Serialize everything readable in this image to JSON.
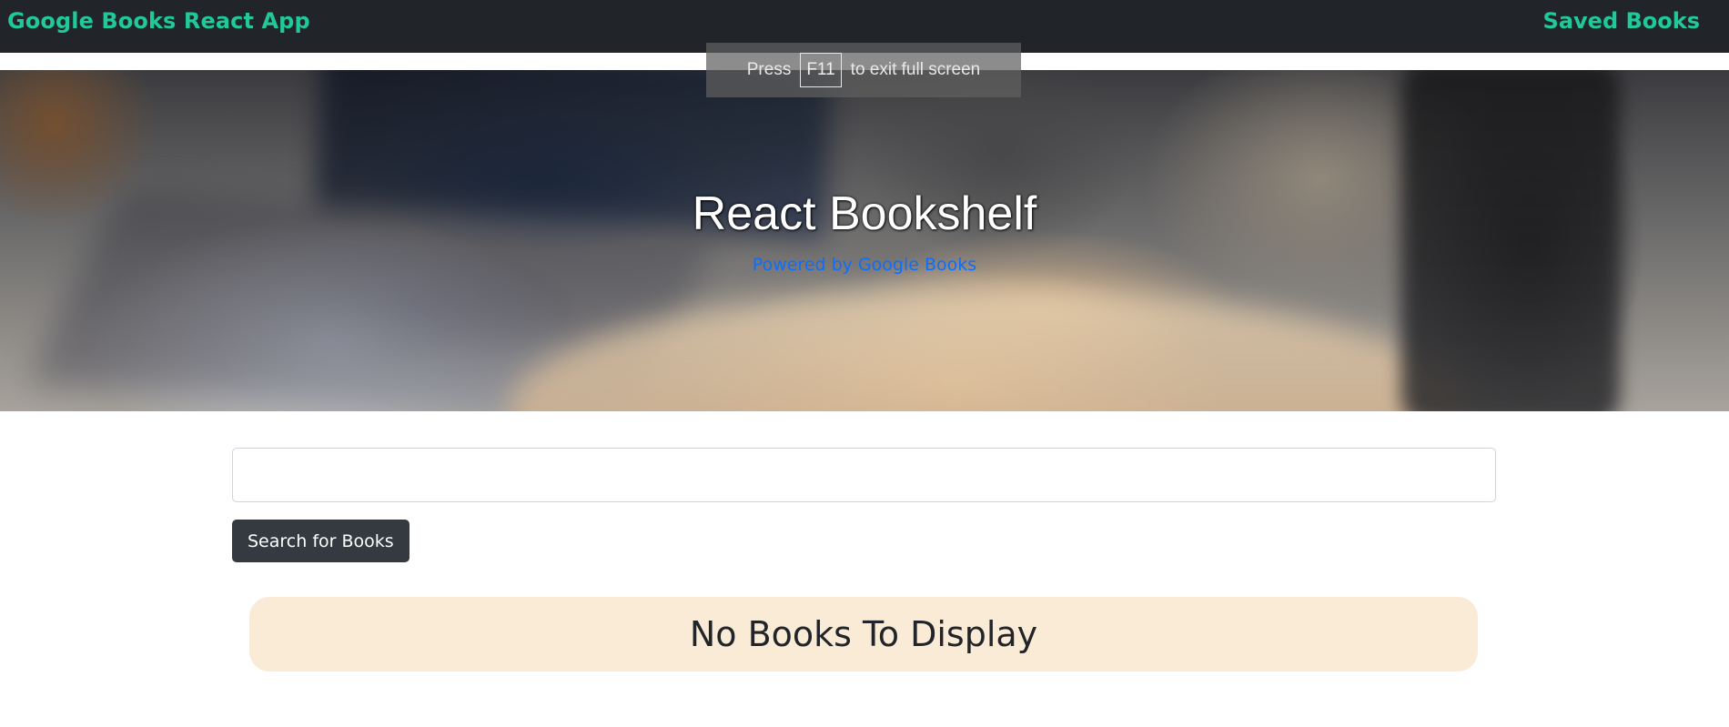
{
  "navbar": {
    "brand": "Google Books React App",
    "saved_link": "Saved Books"
  },
  "fullscreen_notice": {
    "press": "Press",
    "key": "F11",
    "suffix": "to exit full screen"
  },
  "hero": {
    "title": "React Bookshelf",
    "subtitle": "Powered by Google Books"
  },
  "search": {
    "value": "",
    "placeholder": "",
    "button_label": "Search for Books"
  },
  "results": {
    "empty_message": "No Books To Display"
  },
  "colors": {
    "navbar_bg": "#212529",
    "brand_accent": "#20c997",
    "link_blue": "#0d6efd",
    "button_dark": "#343a40",
    "empty_banner_bg": "#faebd7"
  }
}
